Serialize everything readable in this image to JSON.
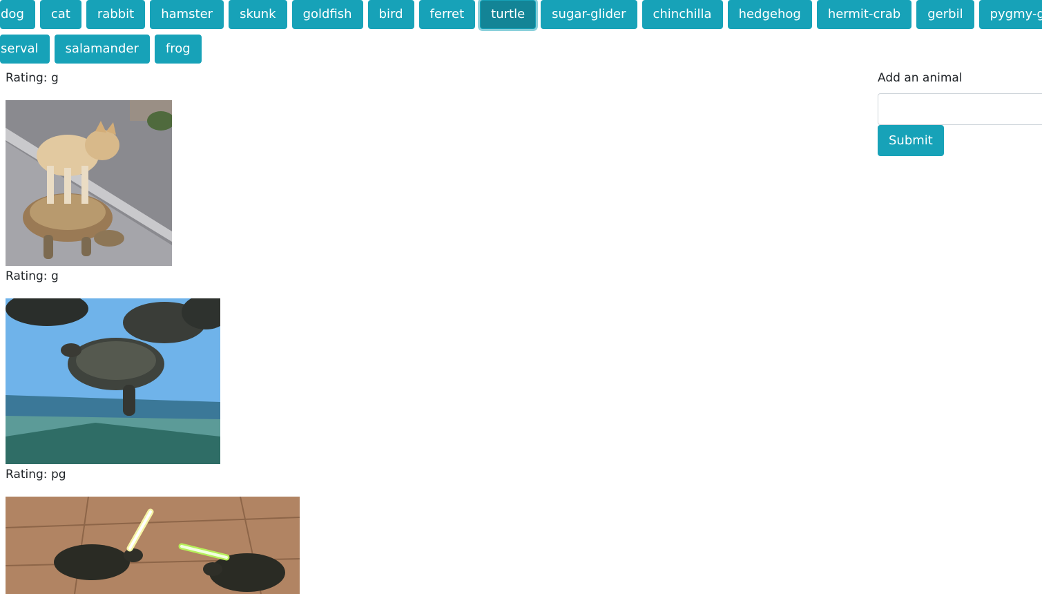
{
  "animal_buttons": {
    "row1": [
      "dog",
      "cat",
      "rabbit",
      "hamster",
      "skunk",
      "goldfish",
      "bird",
      "ferret",
      "turtle",
      "sugar-glider",
      "chinchilla",
      "hedgehog",
      "hermit-crab",
      "gerbil",
      "pygmy-goat"
    ],
    "row2": [
      "serval",
      "salamander",
      "frog"
    ],
    "focused": "turtle"
  },
  "gifs": [
    {
      "rating_label": "Rating: g",
      "subject": "dog-on-tortoise"
    },
    {
      "rating_label": "Rating: g",
      "subject": "turtles-by-pool"
    },
    {
      "rating_label": "Rating: pg",
      "subject": "turtles-with-lightsabers"
    }
  ],
  "form": {
    "label": "Add an animal",
    "input_value": "",
    "submit_label": "Submit"
  },
  "colors": {
    "button_bg": "#17a2b8",
    "button_text": "#ffffff",
    "page_bg": "#ffffff",
    "text": "#212529"
  }
}
